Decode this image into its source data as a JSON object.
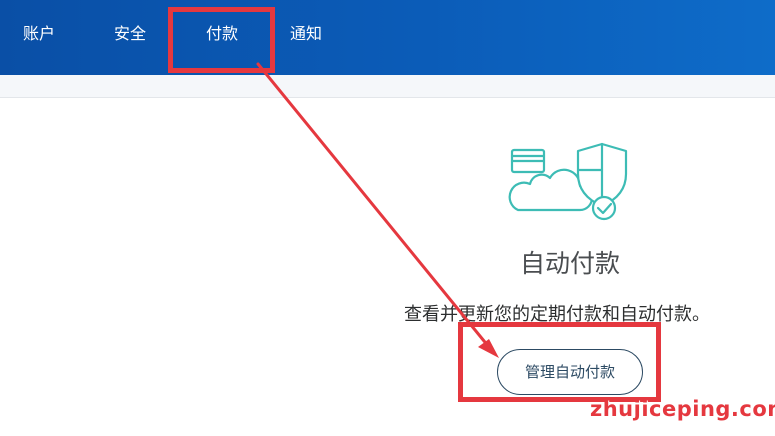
{
  "nav": {
    "tabs": [
      {
        "label": "账户"
      },
      {
        "label": "安全"
      },
      {
        "label": "付款",
        "active": true
      },
      {
        "label": "通知"
      }
    ]
  },
  "autopay": {
    "illustration_icon": "card-cloud-shield-icon",
    "title": "自动付款",
    "description": "查看并更新您的定期付款和自动付款。",
    "manage_button_label": "管理自动付款"
  },
  "annotation": {
    "highlight_color": "#e5383f"
  },
  "watermark": {
    "text": "zhujiceping.com"
  },
  "colors": {
    "nav_background": "#0b5cb8",
    "illustration_teal": "#3dbcb5",
    "button_border": "#2c4a63"
  }
}
